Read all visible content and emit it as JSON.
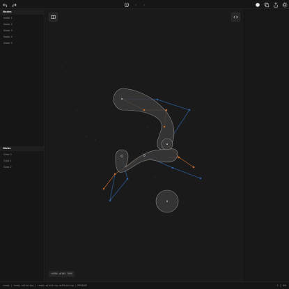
{
  "toolbar": {
    "left_icons": [
      "undo-icon",
      "redo-icon"
    ],
    "center_icons": [
      "target-icon",
      "dot-icon",
      "dot-icon"
    ],
    "right_icons": [
      "circle-fill-icon",
      "copy-icon",
      "share-icon",
      "settings-icon"
    ]
  },
  "sidebar": {
    "nodes_header": "Nodes",
    "nodes": [
      "Node 1",
      "Node 2",
      "Node 3",
      "Node 4",
      "Node 5"
    ],
    "globs_header": "Globs",
    "globs": [
      "Glob 0",
      "Glob 1",
      "Glob 2"
    ]
  },
  "canvas": {
    "coord_readout": "x0000  y0300  1000"
  },
  "status": {
    "left": "ready  |  ready.selecting  |  ready.selecting.notPointing  |  MESSAGE",
    "right": "5  |  160"
  },
  "colors": {
    "background": "#1a1a1a",
    "orange_handle": "#c0682c",
    "blue_handle": "#2f5f9e",
    "glob_fill": "#3b3b3b"
  }
}
